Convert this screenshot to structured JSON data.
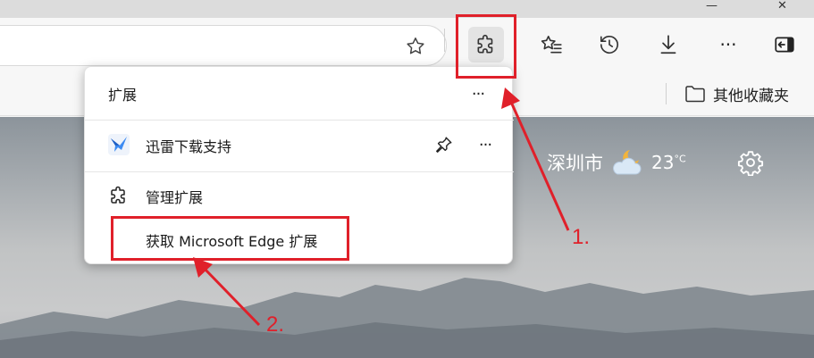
{
  "window": {
    "minimize_label": "—",
    "close_label": "✕"
  },
  "toolbar": {
    "star_icon": "star-outline-icon",
    "extensions_icon": "puzzle-icon",
    "favorites_icon": "favorites-list-icon",
    "history_icon": "history-icon",
    "downloads_icon": "download-icon",
    "more_label": "···",
    "sidebar_icon": "sidebar-toggle-icon"
  },
  "favorites_bar": {
    "other_favorites_label": "其他收藏夹"
  },
  "weather": {
    "city": "深圳市",
    "temperature": "23",
    "unit": "°C"
  },
  "extensions_popup": {
    "title": "扩展",
    "header_more": "···",
    "extensions": [
      {
        "name": "迅雷下载支持",
        "more": "···"
      }
    ],
    "manage_label": "管理扩展",
    "get_label": "获取 Microsoft Edge 扩展"
  },
  "annotations": {
    "step1": "1.",
    "step2": "2.",
    "color": "#e0202a"
  }
}
